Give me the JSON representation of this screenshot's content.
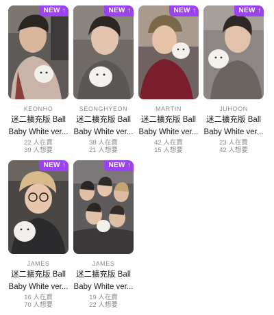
{
  "badge": {
    "label": "NEW",
    "arrow": "↑"
  },
  "colors": {
    "badge_bg": "#9c43f0"
  },
  "cards": [
    {
      "member": "KEONHO",
      "title_line1": "迷二擴充版 Ball",
      "title_line2": "Baby White ver...",
      "sellers": "22 人在賣",
      "wanters": "39 人想要"
    },
    {
      "member": "SEONGHYEON",
      "title_line1": "迷二擴充版 Ball",
      "title_line2": "Baby White ver...",
      "sellers": "38 人在賣",
      "wanters": "21 人想要"
    },
    {
      "member": "MARTIN",
      "title_line1": "迷二擴充版 Ball",
      "title_line2": "Baby White ver...",
      "sellers": "42 人在賣",
      "wanters": "15 人想要"
    },
    {
      "member": "JUHOON",
      "title_line1": "迷二擴充版 Ball",
      "title_line2": "Baby White ver...",
      "sellers": "23 人在賣",
      "wanters": "42 人想要"
    },
    {
      "member": "JAMES",
      "title_line1": "迷二擴充版 Ball",
      "title_line2": "Baby White ver...",
      "sellers": "16 人在賣",
      "wanters": "70 人想要"
    },
    {
      "member": "JAMES",
      "title_line1": "迷二擴充版 Ball",
      "title_line2": "Baby White ver...",
      "sellers": "19 人在賣",
      "wanters": "22 人想要"
    }
  ]
}
